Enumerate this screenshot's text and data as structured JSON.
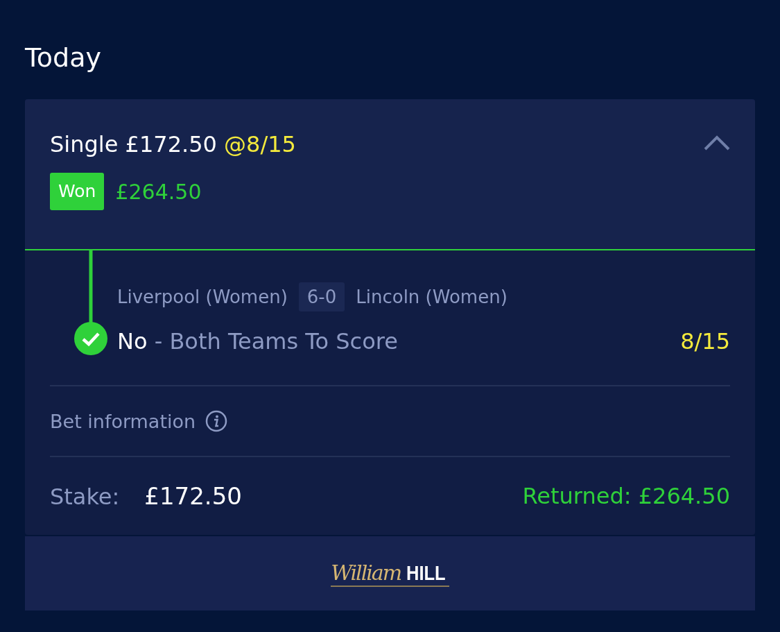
{
  "section_title": "Today",
  "bet": {
    "type": "Single",
    "stake": "£172.50",
    "odds": "@8/15",
    "expanded": true,
    "status": {
      "label": "Won",
      "kind": "won"
    },
    "payout": "£264.50",
    "selections": [
      {
        "home": "Liverpool (Women)",
        "score": "6-0",
        "away": "Lincoln (Women)",
        "pick": "No",
        "separator": "-",
        "market": "Both Teams To Score",
        "odds": "8/15",
        "won": true
      }
    ],
    "info_label": "Bet information",
    "stake_label": "Stake:",
    "stake_value": "£172.50",
    "returned": "Returned: £264.50"
  },
  "footer": {
    "logo_script": "William",
    "logo_bold": "HILL"
  }
}
